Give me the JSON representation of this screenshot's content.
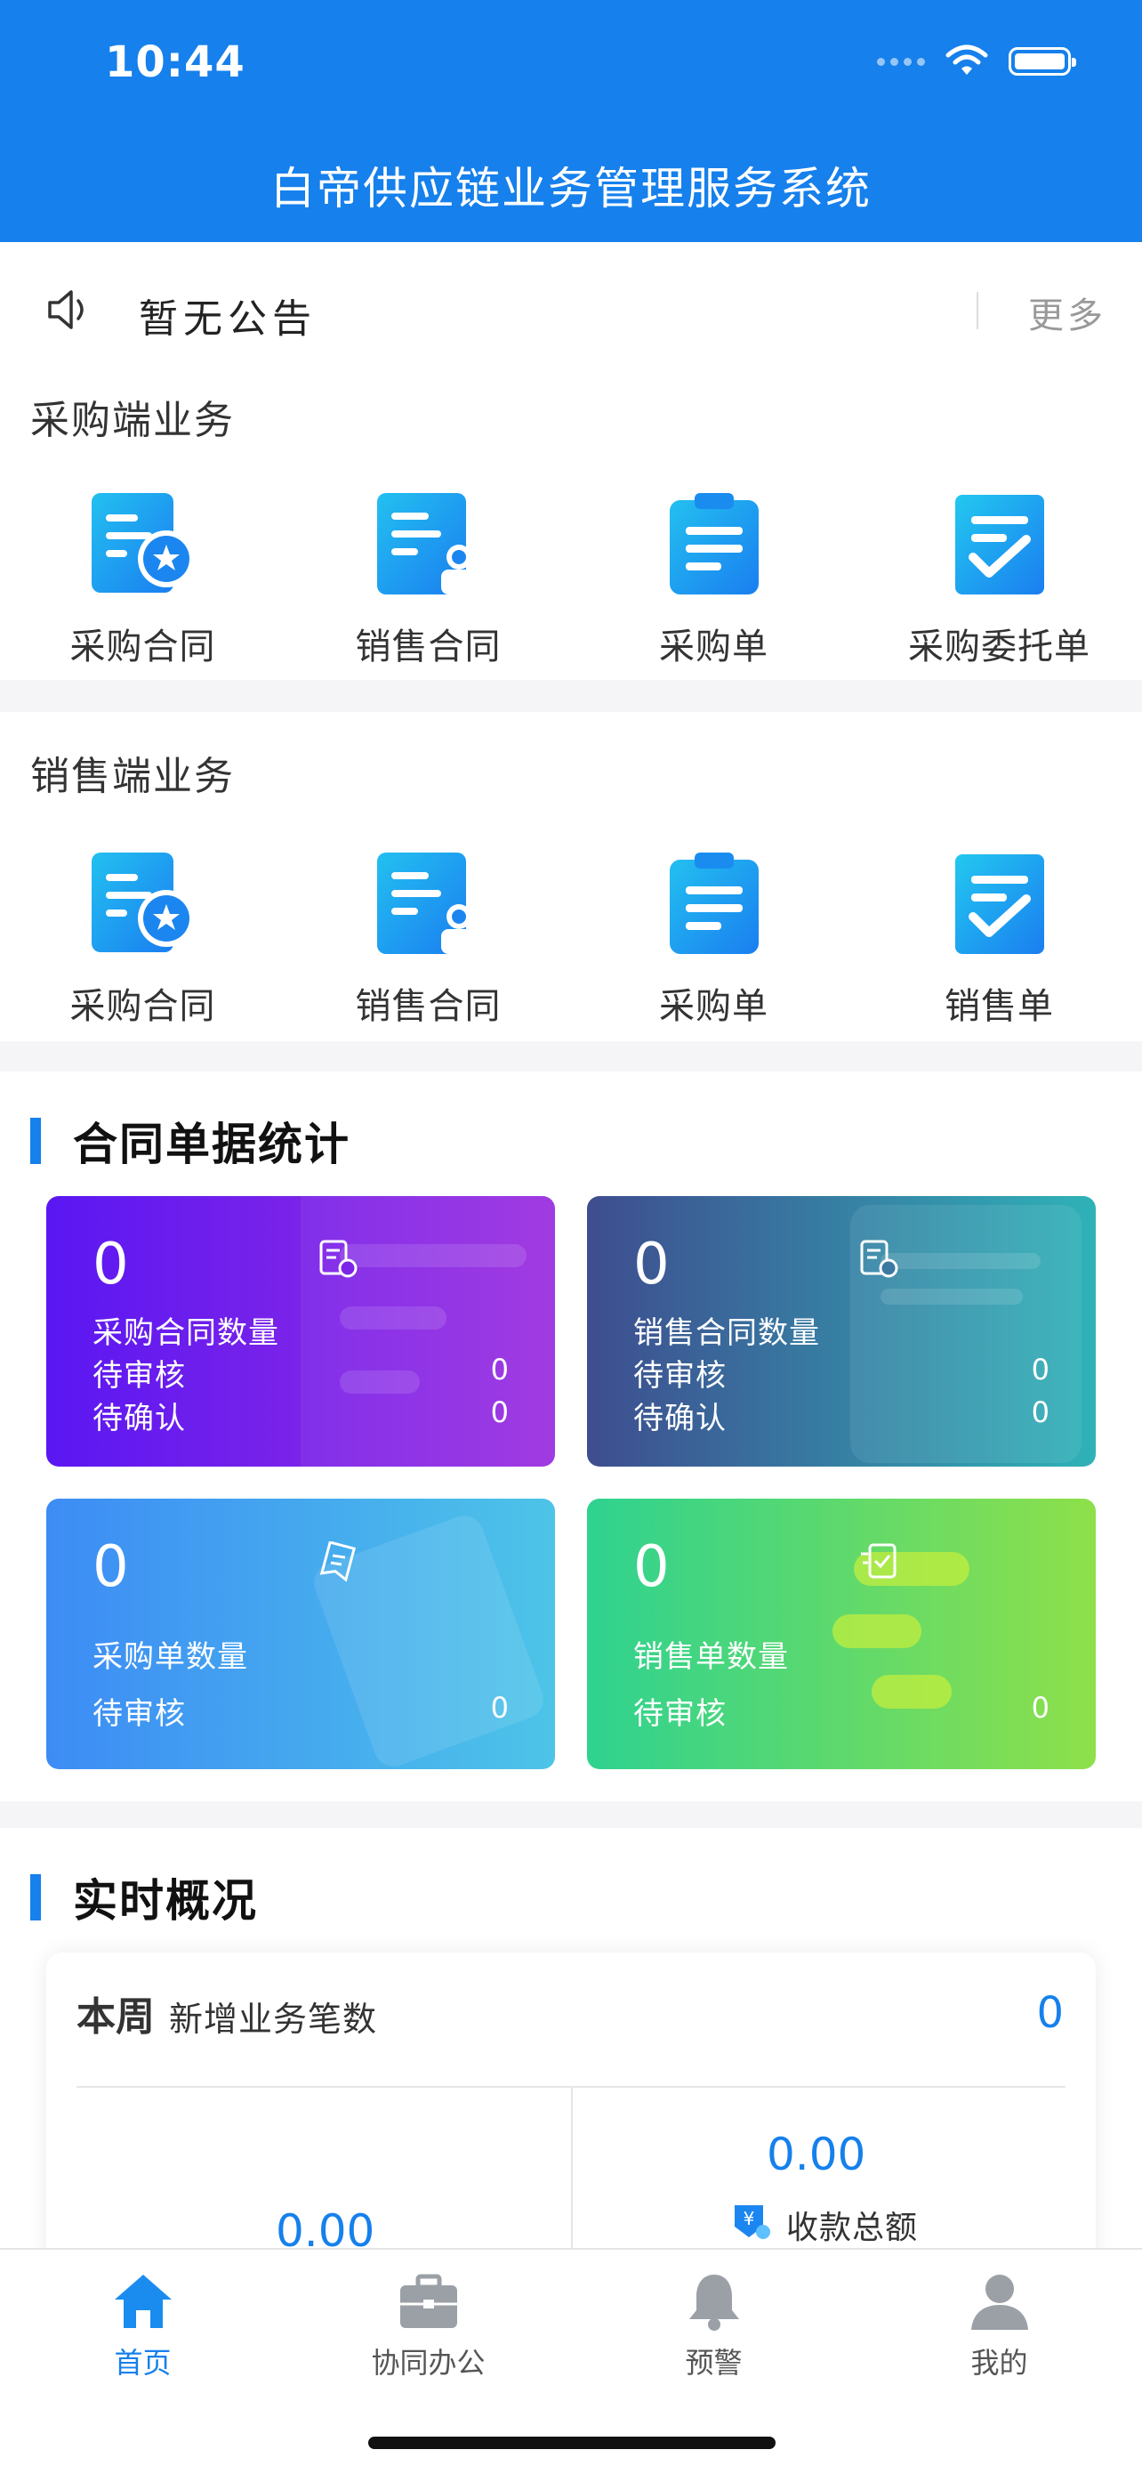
{
  "status_bar": {
    "time": "10:44"
  },
  "header": {
    "title": "白帝供应链业务管理服务系统"
  },
  "notice": {
    "text": "暂无公告",
    "more": "更多"
  },
  "purchase_section": {
    "title": "采购端业务",
    "items": [
      {
        "label": "采购合同",
        "icon": "contract-star-icon"
      },
      {
        "label": "销售合同",
        "icon": "contract-person-icon"
      },
      {
        "label": "采购单",
        "icon": "clipboard-icon"
      },
      {
        "label": "采购委托单",
        "icon": "checklist-icon"
      }
    ]
  },
  "sales_section": {
    "title": "销售端业务",
    "items": [
      {
        "label": "采购合同",
        "icon": "contract-star-icon"
      },
      {
        "label": "销售合同",
        "icon": "contract-person-icon"
      },
      {
        "label": "采购单",
        "icon": "clipboard-icon"
      },
      {
        "label": "销售单",
        "icon": "checklist-icon"
      }
    ]
  },
  "stats": {
    "title": "合同单据统计",
    "cards": [
      {
        "count": "0",
        "title": "采购合同数量",
        "rows": [
          {
            "label": "待审核",
            "value": "0"
          },
          {
            "label": "待确认",
            "value": "0"
          }
        ],
        "color_from": "#5a17f2",
        "color_to": "#9b2fe0"
      },
      {
        "count": "0",
        "title": "销售合同数量",
        "rows": [
          {
            "label": "待审核",
            "value": "0"
          },
          {
            "label": "待确认",
            "value": "0"
          }
        ],
        "color_from": "#3e4d8f",
        "color_to": "#2fb2b8"
      },
      {
        "count": "0",
        "title": "采购单数量",
        "rows": [
          {
            "label": "待审核",
            "value": "0"
          }
        ],
        "color_from": "#3d8cf5",
        "color_to": "#4dc4e8"
      },
      {
        "count": "0",
        "title": "销售单数量",
        "rows": [
          {
            "label": "待审核",
            "value": "0"
          }
        ],
        "color_from": "#2fd290",
        "color_to": "#8ee04a"
      }
    ]
  },
  "realtime": {
    "title": "实时概况",
    "week_label": "本周",
    "week_sub": "新增业务笔数",
    "week_count": "0",
    "amount_right": "0.00",
    "amount_right_label": "收款总额",
    "amount_left": "0.00"
  },
  "tabbar": {
    "tabs": [
      {
        "label": "首页",
        "icon": "home-icon"
      },
      {
        "label": "协同办公",
        "icon": "briefcase-icon"
      },
      {
        "label": "预警",
        "icon": "bell-icon"
      },
      {
        "label": "我的",
        "icon": "user-icon"
      }
    ]
  }
}
